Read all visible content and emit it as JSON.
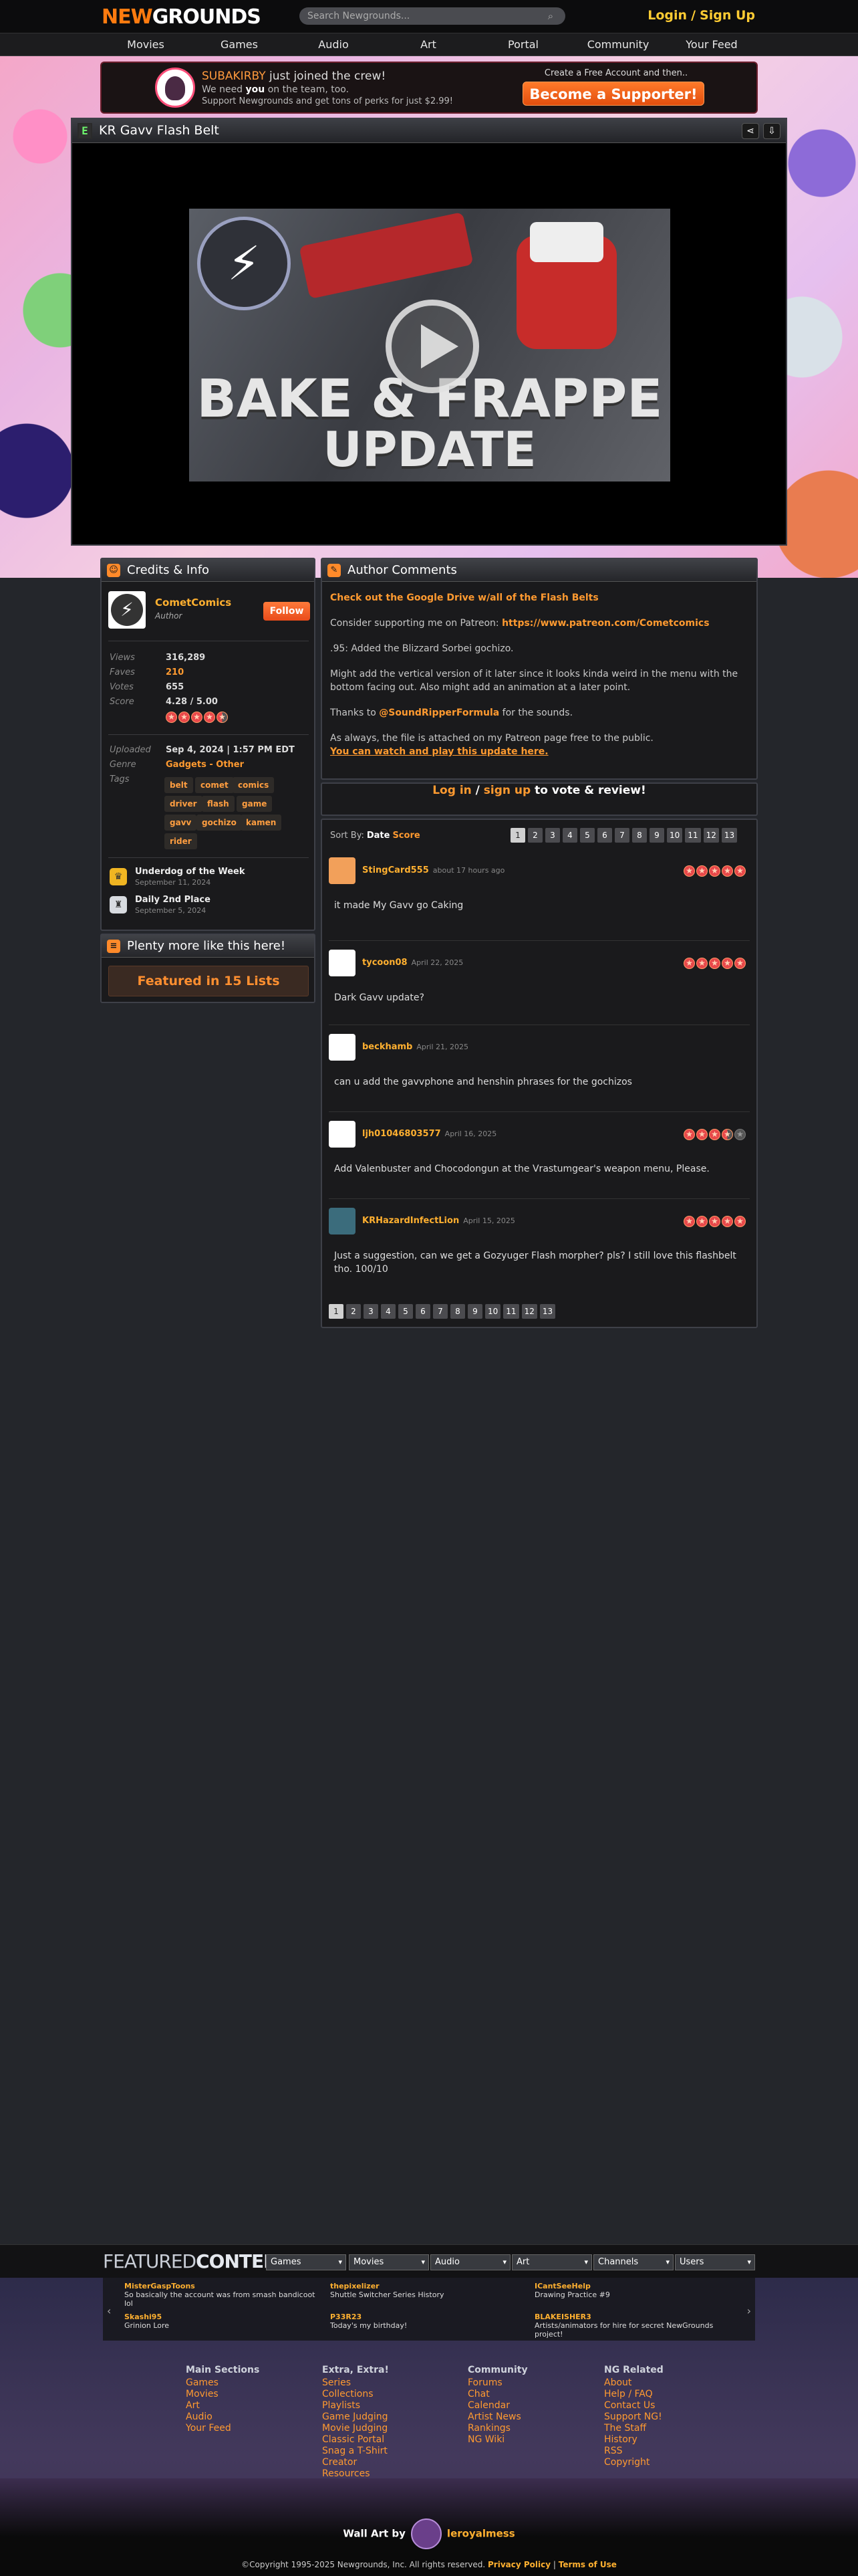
{
  "header": {
    "logo_new": "NEW",
    "logo_grounds": "GROUNDS",
    "search_placeholder": "Search Newgrounds...",
    "login": "Login",
    "signup": "Sign Up"
  },
  "nav": [
    "Movies",
    "Games",
    "Audio",
    "Art",
    "Portal",
    "Community",
    "Your Feed"
  ],
  "promo": {
    "user": "SUBAKIRBY",
    "joined": " just joined the crew!",
    "line2_a": "We need ",
    "line2_b": "you",
    "line2_c": " on the team, too.",
    "line3": "Support Newgrounds and get tons of perks for just $2.99!",
    "create": "Create a Free Account and then..",
    "button": "Become a Supporter!"
  },
  "player": {
    "title": "KR Gavv Flash Belt",
    "thumb_line1": "BAKE & FRAPPE",
    "thumb_line2": "UPDATE"
  },
  "credits": {
    "title": "Credits & Info",
    "author": "CometComics",
    "role": "Author",
    "follow": "Follow",
    "stats": [
      {
        "k": "Views",
        "v": "316,289"
      },
      {
        "k": "Faves",
        "v": "210"
      },
      {
        "k": "Votes",
        "v": "655"
      },
      {
        "k": "Score",
        "v": "4.28 / 5.00"
      }
    ],
    "uploaded_k": "Uploaded",
    "uploaded_v": "Sep 4, 2024",
    "uploaded_t": "1:57 PM EDT",
    "genre_k": "Genre",
    "genre_v": "Gadgets - Other",
    "tags_k": "Tags",
    "tags": [
      "belt",
      "comet",
      "comics",
      "driver",
      "flash",
      "game",
      "gavv",
      "gochizo",
      "kamen",
      "rider"
    ],
    "awards": [
      {
        "t": "Underdog of the Week",
        "d": "September 11, 2024"
      },
      {
        "t": "Daily 2nd Place",
        "d": "September 5, 2024"
      }
    ]
  },
  "more": {
    "title": "Plenty more like this here!",
    "button": "Featured in 15 Lists"
  },
  "comments": {
    "title": "Author Comments",
    "p1": "Check out the Google Drive w/all of the Flash Belts",
    "p2a": "Consider supporting me on Patreon: ",
    "p2b": "https://www.patreon.com/Cometcomics",
    "p3": ".95: Added the Blizzard Sorbei gochizo.",
    "p4": "Might add the vertical version of it later since it looks kinda weird in the menu with the bottom facing out. Also might add an animation at a later point.",
    "p5a": "Thanks to ",
    "p5b": "@SoundRipperFormula",
    "p5c": " for the sounds.",
    "p6": "As always, the file is attached on my Patreon page free to the public.",
    "p7": "You can watch and play this update here."
  },
  "login_bar": {
    "a": "Log in",
    "sep": " / ",
    "b": "sign up",
    "c": " to vote & review!"
  },
  "reviews": {
    "sort_by": "Sort By:",
    "sort_date": "Date",
    "sort_score": "Score",
    "pages": [
      "1",
      "2",
      "3",
      "4",
      "5",
      "6",
      "7",
      "8",
      "9",
      "10",
      "11",
      "12",
      "13"
    ],
    "items": [
      {
        "user": "StingCard555",
        "date": "about 17 hours ago",
        "text": "it made My Gavv go Caking",
        "rating": 5
      },
      {
        "user": "tycoon08",
        "date": "April 22, 2025",
        "text": "Dark Gavv update?",
        "rating": 5
      },
      {
        "user": "beckhamb",
        "date": "April 21, 2025",
        "text": "can u add the gavvphone and henshin phrases for the gochizos",
        "rating": 0
      },
      {
        "user": "ljh01046803577",
        "date": "April 16, 2025",
        "text": "Add Valenbuster and Chocodongun at the Vrastumgear's weapon menu, Please.",
        "rating": 3.5
      },
      {
        "user": "KRHazardInfectLion",
        "date": "April 15, 2025",
        "text": "Just a suggestion, can we get a Gozyuger Flash morpher? pls? I still love this flashbelt tho. 100/10",
        "rating": 5
      }
    ]
  },
  "featured": {
    "title_a": "FEATURED",
    "title_b": "CONTENT",
    "selects": [
      "Games",
      "Movies",
      "Audio",
      "Art",
      "Channels",
      "Users"
    ],
    "ticker": [
      {
        "n": "MisterGaspToons",
        "t": "So basically the account was from smash bandicoot lol"
      },
      {
        "n": "thepixelizer",
        "t": "Shuttle Switcher Series History"
      },
      {
        "n": "ICantSeeHelp",
        "t": "Drawing Practice #9"
      },
      {
        "n": "Skashi95",
        "t": "Grinion Lore"
      },
      {
        "n": "P33R23",
        "t": "Today's my birthday!"
      },
      {
        "n": "BLAKEISHER3",
        "t": "Artists/animators for hire for secret NewGrounds project!"
      }
    ]
  },
  "footer": {
    "cols": [
      {
        "h": "Main Sections",
        "links": [
          "Games",
          "Movies",
          "Art",
          "Audio",
          "Your Feed"
        ]
      },
      {
        "h": "Extra, Extra!",
        "links": [
          "Series",
          "Collections",
          "Playlists",
          "Game Judging",
          "Movie Judging",
          "Classic Portal",
          "Snag a T-Shirt",
          "Creator",
          "Resources"
        ]
      },
      {
        "h": "Community",
        "links": [
          "Forums",
          "Chat",
          "Calendar",
          "Artist News",
          "Rankings",
          "NG Wiki"
        ]
      },
      {
        "h": "NG Related",
        "links": [
          "About",
          "Help / FAQ",
          "Contact Us",
          "Support NG!",
          "The Staff",
          "History",
          "RSS",
          "Copyright"
        ]
      }
    ],
    "wall_art": "Wall Art by",
    "wall_artist": "leroyalmess",
    "copyright": "©Copyright 1995-2025 Newgrounds, Inc. All rights reserved.",
    "privacy": "Privacy Policy",
    "terms": "Terms of Use"
  }
}
